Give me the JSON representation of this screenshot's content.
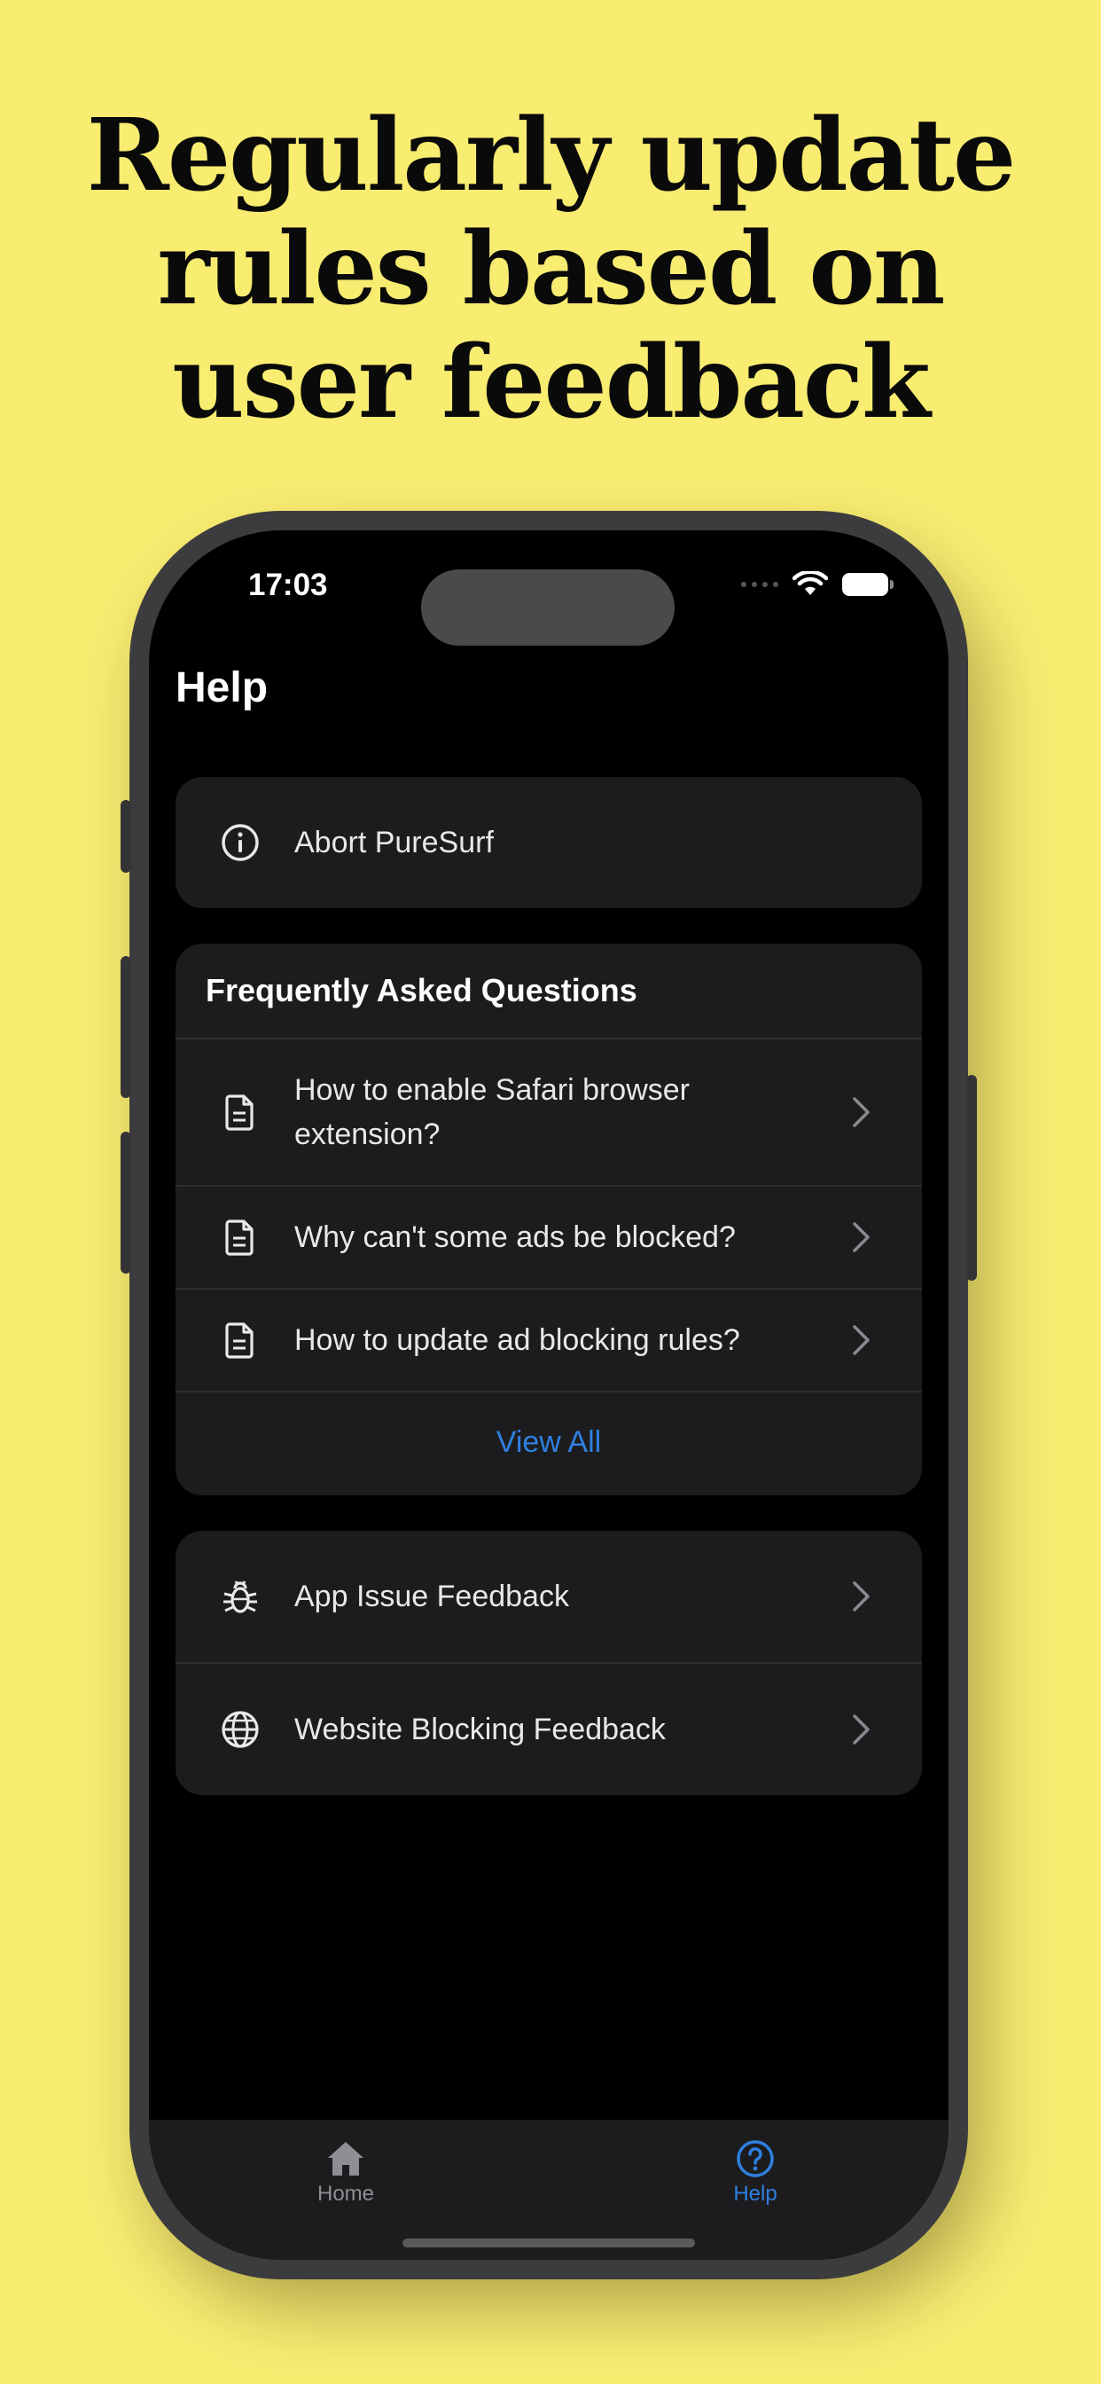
{
  "headline": {
    "line1": "Regularly update",
    "line2": "rules based on",
    "line3": "user feedback"
  },
  "status_bar": {
    "time": "17:03"
  },
  "page": {
    "title": "Help"
  },
  "about": {
    "label": "Abort PureSurf",
    "icon": "info-icon"
  },
  "faq": {
    "title": "Frequently Asked Questions",
    "items": [
      {
        "label": "How to enable Safari browser extension?",
        "icon": "document-icon"
      },
      {
        "label": "Why can't some ads be blocked?",
        "icon": "document-icon"
      },
      {
        "label": "How to update ad blocking rules?",
        "icon": "document-icon"
      }
    ],
    "view_all": "View All"
  },
  "feedback": {
    "items": [
      {
        "label": "App Issue Feedback",
        "icon": "bug-icon"
      },
      {
        "label": "Website Blocking Feedback",
        "icon": "globe-icon"
      }
    ]
  },
  "tabbar": {
    "home": {
      "label": "Home",
      "icon": "home-icon"
    },
    "help": {
      "label": "Help",
      "icon": "help-icon"
    }
  },
  "colors": {
    "background": "#f8ec71",
    "accent": "#2f7fe0",
    "card": "#1c1c1e"
  }
}
